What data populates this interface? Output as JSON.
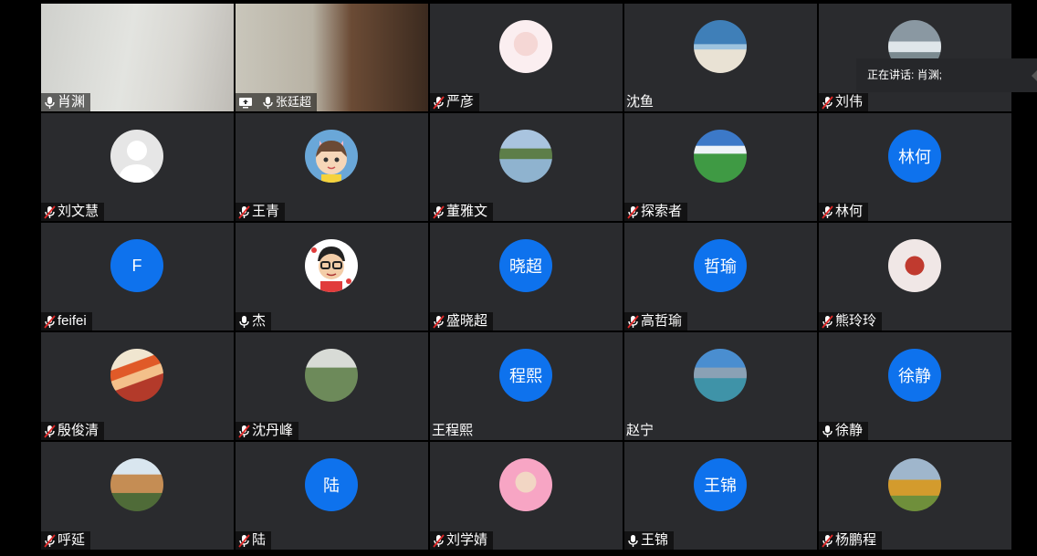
{
  "speaking_banner": "正在讲话: 肖渊;",
  "participants": [
    {
      "name": "肖渊",
      "type": "video",
      "mic": "on"
    },
    {
      "name": "张廷超",
      "type": "video",
      "mic": "on",
      "sharing": true
    },
    {
      "name": "严彦",
      "avatar": "photo-girl",
      "mic": "muted"
    },
    {
      "name": "沈鱼",
      "avatar": "photo-sea",
      "mic": "none"
    },
    {
      "name": "刘伟",
      "avatar": "photo-wave",
      "mic": "muted"
    },
    {
      "name": "刘文慧",
      "avatar": "default-person",
      "mic": "muted"
    },
    {
      "name": "王青",
      "avatar": "cartoon-girl",
      "mic": "muted"
    },
    {
      "name": "董雅文",
      "avatar": "photo-lake",
      "mic": "muted"
    },
    {
      "name": "探索者",
      "avatar": "photo-landscape",
      "mic": "muted"
    },
    {
      "name": "林何",
      "avatar_text": "林何",
      "mic": "muted"
    },
    {
      "name": "feifei",
      "avatar_text": "F",
      "mic": "muted"
    },
    {
      "name": "杰",
      "avatar": "cartoon-glasses",
      "mic": "on"
    },
    {
      "name": "盛晓超",
      "avatar_text": "晓超",
      "mic": "muted"
    },
    {
      "name": "高哲瑜",
      "avatar_text": "哲瑜",
      "mic": "muted"
    },
    {
      "name": "熊玲玲",
      "avatar": "photo-red",
      "mic": "muted"
    },
    {
      "name": "殷俊清",
      "avatar": "photo-food",
      "mic": "muted"
    },
    {
      "name": "沈丹峰",
      "avatar": "photo-hill",
      "mic": "muted"
    },
    {
      "name": "王程熙",
      "avatar_text": "程熙",
      "mic": "none"
    },
    {
      "name": "赵宁",
      "avatar": "photo-mountain",
      "mic": "none"
    },
    {
      "name": "徐静",
      "avatar_text": "徐静",
      "mic": "on"
    },
    {
      "name": "呼延",
      "avatar": "photo-town",
      "mic": "muted"
    },
    {
      "name": "陆",
      "avatar_text": "陆",
      "mic": "muted"
    },
    {
      "name": "刘学婧",
      "avatar": "photo-pink",
      "mic": "muted"
    },
    {
      "name": "王锦",
      "avatar_text": "王锦",
      "mic": "on"
    },
    {
      "name": "杨鹏程",
      "avatar": "photo-tree",
      "mic": "muted"
    }
  ]
}
